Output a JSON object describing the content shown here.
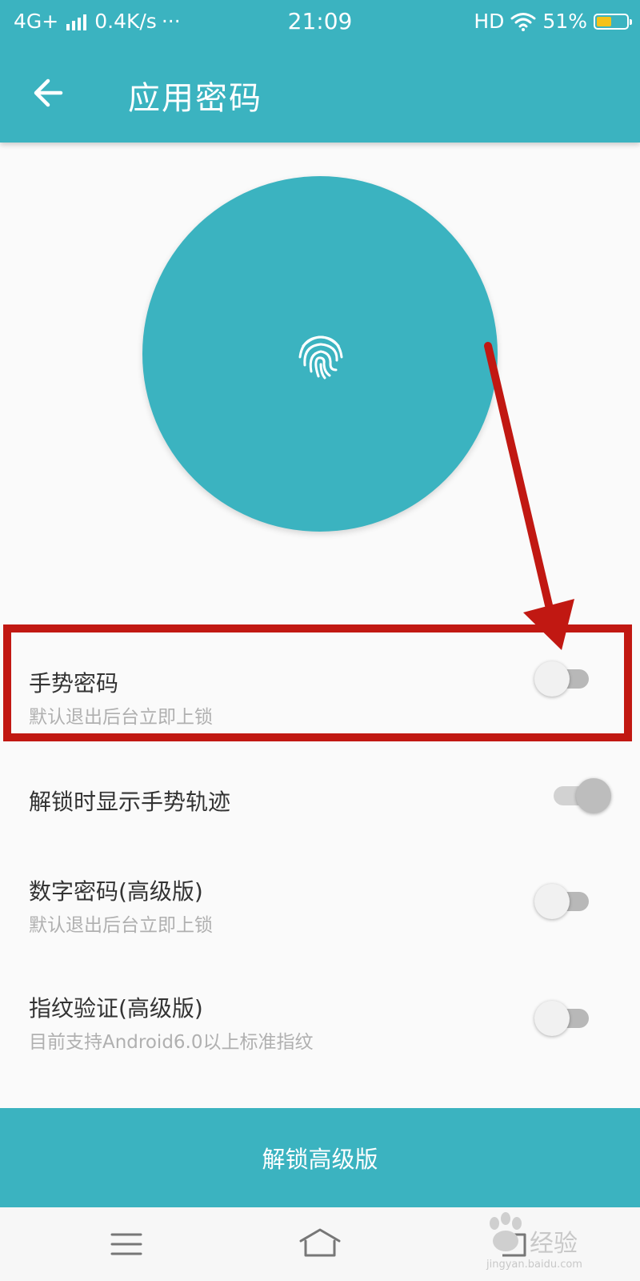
{
  "status_bar": {
    "network": "4G+",
    "speed": "0.4K/s",
    "more": "···",
    "time": "21:09",
    "hd": "HD",
    "battery": "51%",
    "battery_level": 0.51
  },
  "header": {
    "title": "应用密码"
  },
  "settings": [
    {
      "title": "手势密码",
      "subtitle": "默认退出后台立即上锁",
      "toggle": "off"
    },
    {
      "title": "解锁时显示手势轨迹",
      "subtitle": "",
      "toggle": "on-disabled"
    },
    {
      "title": "数字密码(高级版)",
      "subtitle": "默认退出后台立即上锁",
      "toggle": "off"
    },
    {
      "title": "指纹验证(高级版)",
      "subtitle": "目前支持Android6.0以上标准指纹",
      "toggle": "off"
    }
  ],
  "unlock_button": {
    "label": "解锁高级版"
  },
  "watermark": {
    "text": "经验",
    "sub": "jingyan.baidu.com"
  },
  "colors": {
    "accent": "#3bb3c0",
    "annotation": "#c11812"
  }
}
